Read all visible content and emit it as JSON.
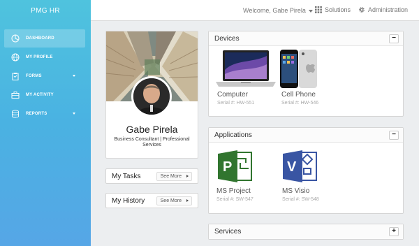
{
  "brand": "PMG HR",
  "nav": [
    {
      "label": "DASHBOARD",
      "icon": "dashboard-icon",
      "active": true
    },
    {
      "label": "MY PROFILE",
      "icon": "globe-icon"
    },
    {
      "label": "FORMS",
      "icon": "clipboard-icon",
      "dropdown": true
    },
    {
      "label": "MY ACTIVITY",
      "icon": "briefcase-icon"
    },
    {
      "label": "REPORTS",
      "icon": "database-icon",
      "dropdown": true
    }
  ],
  "topbar": {
    "welcome": "Welcome, Gabe Pirela",
    "solutions": "Solutions",
    "administration": "Administration"
  },
  "profile": {
    "name": "Gabe Pirela",
    "title": "Business Consultant | Professional Services"
  },
  "links": {
    "tasks": {
      "title": "My Tasks",
      "see_more": "See More"
    },
    "history": {
      "title": "My History",
      "see_more": "See More"
    }
  },
  "devices": {
    "title": "Devices",
    "toggle": "−",
    "items": [
      {
        "label": "Computer",
        "serial": "Serial #: HW-551"
      },
      {
        "label": "Cell Phone",
        "serial": "Serial #: HW-546"
      }
    ]
  },
  "applications": {
    "title": "Applications",
    "toggle": "−",
    "items": [
      {
        "label": "MS Project",
        "serial": "Serial #: SW-547",
        "color": "#31752f"
      },
      {
        "label": "MS Visio",
        "serial": "Serial #: SW-548",
        "color": "#3955a3"
      }
    ]
  },
  "services": {
    "title": "Services",
    "toggle": "+"
  },
  "colors": {
    "sidebar_top": "#4fc3de",
    "sidebar_bottom": "#56a6e6"
  }
}
